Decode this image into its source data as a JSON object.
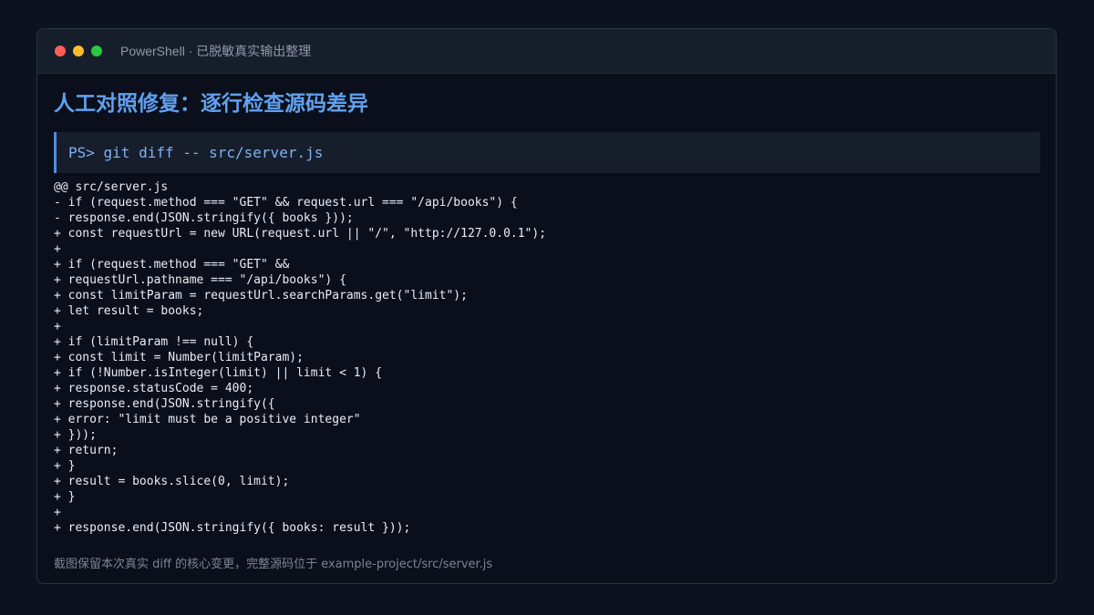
{
  "window": {
    "title": "PowerShell · 已脱敏真实输出整理",
    "controls": {
      "close_color": "#ff5f57",
      "minimize_color": "#febc2e",
      "maximize_color": "#28c840"
    }
  },
  "heading": "人工对照修复：逐行检查源码差异",
  "command": "PS> git diff -- src/server.js",
  "diff_lines": [
    "@@ src/server.js",
    "- if (request.method === \"GET\" && request.url === \"/api/books\") {",
    "- response.end(JSON.stringify({ books }));",
    "+ const requestUrl = new URL(request.url || \"/\", \"http://127.0.0.1\");",
    "+",
    "+ if (request.method === \"GET\" &&",
    "+ requestUrl.pathname === \"/api/books\") {",
    "+ const limitParam = requestUrl.searchParams.get(\"limit\");",
    "+ let result = books;",
    "+",
    "+ if (limitParam !== null) {",
    "+ const limit = Number(limitParam);",
    "+ if (!Number.isInteger(limit) || limit < 1) {",
    "+ response.statusCode = 400;",
    "+ response.end(JSON.stringify({",
    "+ error: \"limit must be a positive integer\"",
    "+ }));",
    "+ return;",
    "+ }",
    "+ result = books.slice(0, limit);",
    "+ }",
    "+",
    "+ response.end(JSON.stringify({ books: result }));"
  ],
  "footer": "截图保留本次真实 diff 的核心变更，完整源码位于 example-project/src/server.js"
}
